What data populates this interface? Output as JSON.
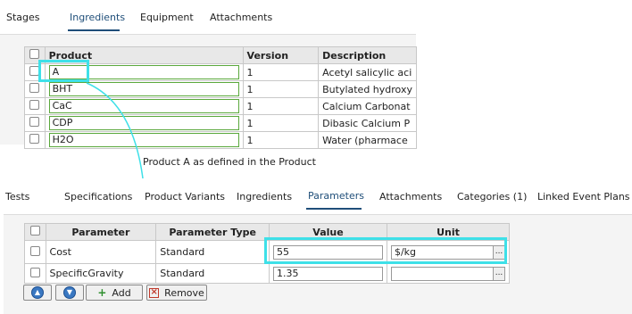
{
  "top": {
    "tabs": [
      "Stages",
      "Ingredients",
      "Equipment",
      "Attachments"
    ],
    "active_tab": "Ingredients",
    "columns": [
      "Product",
      "Version",
      "Description"
    ],
    "rows": [
      {
        "product": "A",
        "version": "1",
        "description": "Acetyl salicylic aci"
      },
      {
        "product": "BHT",
        "version": "1",
        "description": "Butylated hydroxy"
      },
      {
        "product": "CaC",
        "version": "1",
        "description": "Calcium Carbonat"
      },
      {
        "product": "CDP",
        "version": "1",
        "description": "Dibasic Calcium P"
      },
      {
        "product": "H2O",
        "version": "1",
        "description": "Water (pharmace"
      }
    ]
  },
  "caption": "Product A as defined in the Product",
  "bottom": {
    "tabs": [
      "Tests",
      "Specifications",
      "Product Variants",
      "Ingredients",
      "Parameters",
      "Attachments",
      "Categories (1)",
      "Linked Event Plans"
    ],
    "active_tab": "Parameters",
    "columns": [
      "Parameter",
      "Parameter Type",
      "Value",
      "Unit"
    ],
    "rows": [
      {
        "parameter": "Cost",
        "type": "Standard",
        "value": "55",
        "unit": "$/kg"
      },
      {
        "parameter": "SpecificGravity",
        "type": "Standard",
        "value": "1.35",
        "unit": ""
      }
    ],
    "buttons": {
      "add": "Add",
      "remove": "Remove",
      "ellipsis": "..."
    }
  },
  "colors": {
    "highlight": "#3ee0e8",
    "active_tab": "#1f4e79",
    "product_border": "#5aa83c"
  }
}
